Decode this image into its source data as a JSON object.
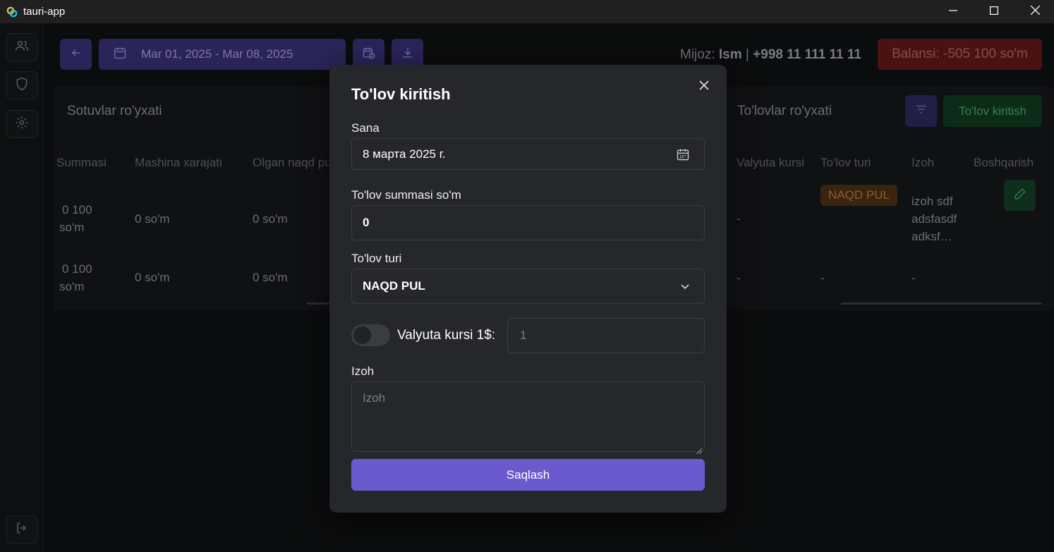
{
  "window": {
    "title": "tauri-app"
  },
  "topbar": {
    "date_range": "Mar 01, 2025 - Mar 08, 2025",
    "client_prefix": "Mijoz: ",
    "client_name": "Ism",
    "client_sep": " | ",
    "client_phone": "+998 11 111 11 11",
    "balance": "Balansi: -505 100 so'm"
  },
  "sales_panel": {
    "title": "Sotuvlar ro'yxati",
    "columns": [
      "Summasi",
      "Mashina xarajati",
      "Olgan naqd pul"
    ],
    "rows": [
      {
        "summa_line1": "0 100",
        "summa_line2": "so'm",
        "mashina": "0 so'm",
        "olgan": "0 so'm"
      },
      {
        "summa_line1": "0 100",
        "summa_line2": "so'm",
        "mashina": "0 so'm",
        "olgan": "0 so'm"
      }
    ]
  },
  "payments_panel": {
    "title": "To'lovlar ro'yxati",
    "add_label": "To'lov kiritish",
    "columns": [
      "Valyuta kursi",
      "To'lov turi",
      "Izoh",
      "Boshqarish"
    ],
    "rows": [
      {
        "kurs": "-",
        "turi": "NAQD PUL",
        "izoh_1": "izoh sdf",
        "izoh_2": "adsfasdf",
        "izoh_3": "adksf…"
      },
      {
        "kurs": "-",
        "turi": "-",
        "izoh": "-"
      }
    ]
  },
  "modal": {
    "title": "To'lov kiritish",
    "date_label": "Sana",
    "date_value": "8 марта 2025 г.",
    "amount_label": "To'lov summasi so'm",
    "amount_value": "0",
    "type_label": "To'lov turi",
    "type_value": "NAQD PUL",
    "currency_toggle_label": "Valyuta kursi 1$:",
    "currency_toggle_on": false,
    "rate_placeholder": "1",
    "note_label": "Izoh",
    "note_placeholder": "Izoh",
    "save_label": "Saqlash"
  },
  "colors": {
    "accent": "#6a5acd",
    "modal_bg": "#25272b",
    "danger": "#4a1313",
    "success": "#0c2c18"
  }
}
